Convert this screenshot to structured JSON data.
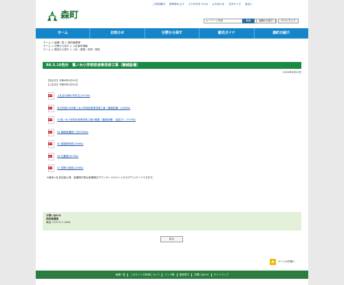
{
  "utility": {
    "links": [
      "ご利用案内",
      "音声読み上げ",
      "ふりがなをつける",
      "よみあげる",
      "文字サイズ",
      "色合い"
    ]
  },
  "header": {
    "logo_text": "森町",
    "search_placeholder": "キーワード検索",
    "search_button": "検索",
    "org_button": "組織から探す",
    "sitemap_button": "サイトマップ"
  },
  "nav": {
    "items": [
      "ホーム",
      "お知らせ",
      "分野から探す",
      "観光ガイド",
      "森町の紹介"
    ]
  },
  "breadcrumbs": [
    "ホーム > 組織一覧 > 契約管理課",
    "ホーム > 分野から探す > 入札案件情報",
    "ホーム > 属性から探す > 入札・調達・売却・契約"
  ],
  "page": {
    "title": "R6.5.10告示　鷲ノ木小学校校舎等改修工事（機械設備）",
    "date": "2024年5月10日",
    "notice_date": "【告示日】令和6年5月10日",
    "bid_date": "【入札日】令和6年5月31日"
  },
  "files": [
    "入札告示第62号本文(207KB)",
    "告示別表1008鷲ノ木小学校校舎等改修工事（機械設備）(283KB)",
    "01鷲ノ木小学校校舎等改修工事の概要（機械設備）（金抜き）(757KB)",
    "04.機械設備図一式(876KB)",
    "05.現場説明書(336KB)",
    "06.位置図(307KB)",
    "07.質問工程表(149KB)"
  ],
  "note": "※競争入札参加者心得、各種様式等は各種様式ダウンロードのページからダウンロードできます。",
  "contact": {
    "heading": "お問い合わせ",
    "dept": "契約管理課",
    "tel": "電話: 01374-7-1086"
  },
  "back_button": "戻る",
  "page_top": "ページの先頭へ",
  "footer": {
    "links": [
      "組織一覧",
      "このサイトの利用について",
      "リンク集",
      "相談窓口",
      "お問い合わせ",
      "サイトマップ"
    ]
  },
  "colors": {
    "nav_blue": "#1585c9",
    "title_green": "#1b8a44",
    "footer_green": "#2a7d3f",
    "contact_bg": "#e4f1da"
  }
}
